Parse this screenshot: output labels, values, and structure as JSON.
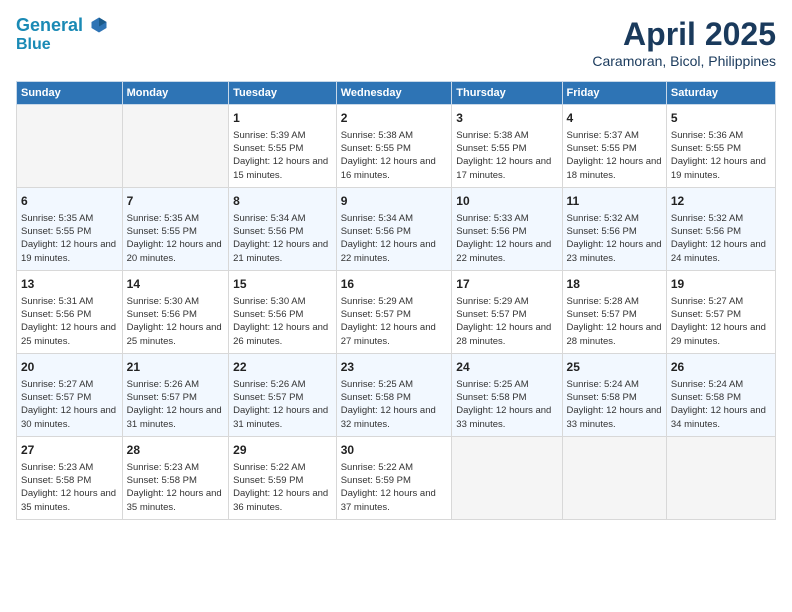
{
  "header": {
    "logo_line1": "General",
    "logo_line2": "Blue",
    "title": "April 2025",
    "subtitle": "Caramoran, Bicol, Philippines"
  },
  "days_of_week": [
    "Sunday",
    "Monday",
    "Tuesday",
    "Wednesday",
    "Thursday",
    "Friday",
    "Saturday"
  ],
  "weeks": [
    [
      {
        "day": "",
        "info": ""
      },
      {
        "day": "",
        "info": ""
      },
      {
        "day": "1",
        "sunrise": "Sunrise: 5:39 AM",
        "sunset": "Sunset: 5:55 PM",
        "daylight": "Daylight: 12 hours and 15 minutes."
      },
      {
        "day": "2",
        "sunrise": "Sunrise: 5:38 AM",
        "sunset": "Sunset: 5:55 PM",
        "daylight": "Daylight: 12 hours and 16 minutes."
      },
      {
        "day": "3",
        "sunrise": "Sunrise: 5:38 AM",
        "sunset": "Sunset: 5:55 PM",
        "daylight": "Daylight: 12 hours and 17 minutes."
      },
      {
        "day": "4",
        "sunrise": "Sunrise: 5:37 AM",
        "sunset": "Sunset: 5:55 PM",
        "daylight": "Daylight: 12 hours and 18 minutes."
      },
      {
        "day": "5",
        "sunrise": "Sunrise: 5:36 AM",
        "sunset": "Sunset: 5:55 PM",
        "daylight": "Daylight: 12 hours and 19 minutes."
      }
    ],
    [
      {
        "day": "6",
        "sunrise": "Sunrise: 5:35 AM",
        "sunset": "Sunset: 5:55 PM",
        "daylight": "Daylight: 12 hours and 19 minutes."
      },
      {
        "day": "7",
        "sunrise": "Sunrise: 5:35 AM",
        "sunset": "Sunset: 5:55 PM",
        "daylight": "Daylight: 12 hours and 20 minutes."
      },
      {
        "day": "8",
        "sunrise": "Sunrise: 5:34 AM",
        "sunset": "Sunset: 5:56 PM",
        "daylight": "Daylight: 12 hours and 21 minutes."
      },
      {
        "day": "9",
        "sunrise": "Sunrise: 5:34 AM",
        "sunset": "Sunset: 5:56 PM",
        "daylight": "Daylight: 12 hours and 22 minutes."
      },
      {
        "day": "10",
        "sunrise": "Sunrise: 5:33 AM",
        "sunset": "Sunset: 5:56 PM",
        "daylight": "Daylight: 12 hours and 22 minutes."
      },
      {
        "day": "11",
        "sunrise": "Sunrise: 5:32 AM",
        "sunset": "Sunset: 5:56 PM",
        "daylight": "Daylight: 12 hours and 23 minutes."
      },
      {
        "day": "12",
        "sunrise": "Sunrise: 5:32 AM",
        "sunset": "Sunset: 5:56 PM",
        "daylight": "Daylight: 12 hours and 24 minutes."
      }
    ],
    [
      {
        "day": "13",
        "sunrise": "Sunrise: 5:31 AM",
        "sunset": "Sunset: 5:56 PM",
        "daylight": "Daylight: 12 hours and 25 minutes."
      },
      {
        "day": "14",
        "sunrise": "Sunrise: 5:30 AM",
        "sunset": "Sunset: 5:56 PM",
        "daylight": "Daylight: 12 hours and 25 minutes."
      },
      {
        "day": "15",
        "sunrise": "Sunrise: 5:30 AM",
        "sunset": "Sunset: 5:56 PM",
        "daylight": "Daylight: 12 hours and 26 minutes."
      },
      {
        "day": "16",
        "sunrise": "Sunrise: 5:29 AM",
        "sunset": "Sunset: 5:57 PM",
        "daylight": "Daylight: 12 hours and 27 minutes."
      },
      {
        "day": "17",
        "sunrise": "Sunrise: 5:29 AM",
        "sunset": "Sunset: 5:57 PM",
        "daylight": "Daylight: 12 hours and 28 minutes."
      },
      {
        "day": "18",
        "sunrise": "Sunrise: 5:28 AM",
        "sunset": "Sunset: 5:57 PM",
        "daylight": "Daylight: 12 hours and 28 minutes."
      },
      {
        "day": "19",
        "sunrise": "Sunrise: 5:27 AM",
        "sunset": "Sunset: 5:57 PM",
        "daylight": "Daylight: 12 hours and 29 minutes."
      }
    ],
    [
      {
        "day": "20",
        "sunrise": "Sunrise: 5:27 AM",
        "sunset": "Sunset: 5:57 PM",
        "daylight": "Daylight: 12 hours and 30 minutes."
      },
      {
        "day": "21",
        "sunrise": "Sunrise: 5:26 AM",
        "sunset": "Sunset: 5:57 PM",
        "daylight": "Daylight: 12 hours and 31 minutes."
      },
      {
        "day": "22",
        "sunrise": "Sunrise: 5:26 AM",
        "sunset": "Sunset: 5:57 PM",
        "daylight": "Daylight: 12 hours and 31 minutes."
      },
      {
        "day": "23",
        "sunrise": "Sunrise: 5:25 AM",
        "sunset": "Sunset: 5:58 PM",
        "daylight": "Daylight: 12 hours and 32 minutes."
      },
      {
        "day": "24",
        "sunrise": "Sunrise: 5:25 AM",
        "sunset": "Sunset: 5:58 PM",
        "daylight": "Daylight: 12 hours and 33 minutes."
      },
      {
        "day": "25",
        "sunrise": "Sunrise: 5:24 AM",
        "sunset": "Sunset: 5:58 PM",
        "daylight": "Daylight: 12 hours and 33 minutes."
      },
      {
        "day": "26",
        "sunrise": "Sunrise: 5:24 AM",
        "sunset": "Sunset: 5:58 PM",
        "daylight": "Daylight: 12 hours and 34 minutes."
      }
    ],
    [
      {
        "day": "27",
        "sunrise": "Sunrise: 5:23 AM",
        "sunset": "Sunset: 5:58 PM",
        "daylight": "Daylight: 12 hours and 35 minutes."
      },
      {
        "day": "28",
        "sunrise": "Sunrise: 5:23 AM",
        "sunset": "Sunset: 5:58 PM",
        "daylight": "Daylight: 12 hours and 35 minutes."
      },
      {
        "day": "29",
        "sunrise": "Sunrise: 5:22 AM",
        "sunset": "Sunset: 5:59 PM",
        "daylight": "Daylight: 12 hours and 36 minutes."
      },
      {
        "day": "30",
        "sunrise": "Sunrise: 5:22 AM",
        "sunset": "Sunset: 5:59 PM",
        "daylight": "Daylight: 12 hours and 37 minutes."
      },
      {
        "day": "",
        "info": ""
      },
      {
        "day": "",
        "info": ""
      },
      {
        "day": "",
        "info": ""
      }
    ]
  ]
}
